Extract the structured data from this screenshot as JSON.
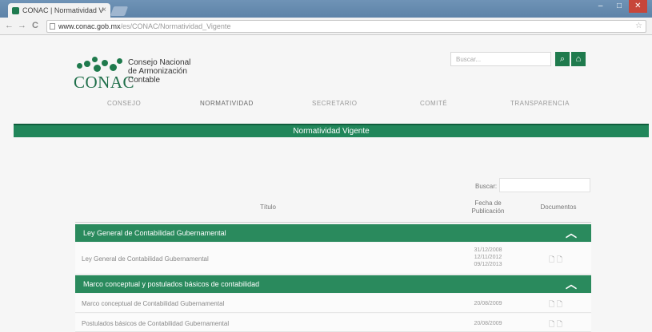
{
  "browser": {
    "tab_title": "CONAC | Normatividad V",
    "tab_close": "×",
    "window_controls": [
      "–",
      "□",
      "✕"
    ],
    "nav": {
      "back": "←",
      "forward": "→",
      "reload": "C"
    },
    "url_host": "www.conac.gob.mx",
    "url_path": "/es/CONAC/Normatividad_Vigente",
    "star": "☆"
  },
  "logo": {
    "name": "CONAC",
    "line1": "Consejo Nacional",
    "line2": "de Armonización",
    "line3": "Contable"
  },
  "search": {
    "placeholder": "Buscar...",
    "search_icon": "⌕",
    "home_icon": "⌂"
  },
  "nav_items": [
    "CONSEJO",
    "NORMATIVIDAD",
    "SECRETARIO",
    "COMITÉ",
    "TRANSPARENCIA"
  ],
  "banner": "Normatividad Vigente",
  "table": {
    "search_label": "Buscar:",
    "headers": {
      "title": "Título",
      "date_line1": "Fecha de",
      "date_line2": "Publicación",
      "docs": "Documentos"
    },
    "groups": [
      {
        "title": "Ley General de Contabilidad Gubernamental",
        "rows": [
          {
            "title": "Ley General de Contabilidad Gubernamental",
            "dates": [
              "31/12/2008",
              "12/11/2012",
              "09/12/2013"
            ],
            "docs": "🗋 🗋"
          }
        ]
      },
      {
        "title": "Marco conceptual y postulados básicos de contabilidad",
        "rows": [
          {
            "title": "Marco conceptual de Contabilidad Gubernamental",
            "dates": [
              "20/08/2009"
            ],
            "docs": "🗋 🗋"
          },
          {
            "title": "Postulados básicos de Contabilidad Gubernamental",
            "dates": [
              "20/08/2009"
            ],
            "docs": "🗋 🗋"
          }
        ]
      }
    ],
    "chevron": "︿"
  }
}
